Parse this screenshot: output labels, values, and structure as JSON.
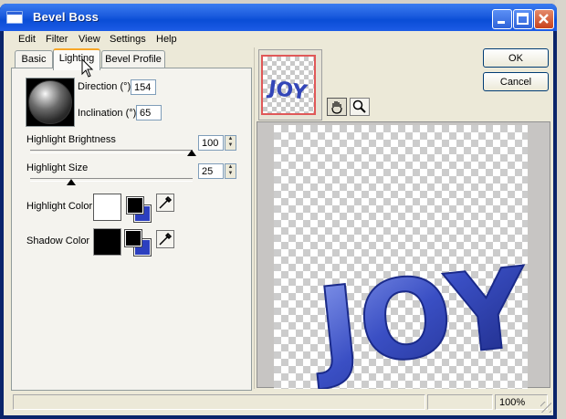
{
  "window": {
    "title": "Bevel Boss"
  },
  "menu": [
    "Edit",
    "Filter",
    "View",
    "Settings",
    "Help"
  ],
  "tabs": [
    {
      "label": "Basic",
      "active": false
    },
    {
      "label": "Lighting",
      "active": true
    },
    {
      "label": "Bevel Profile",
      "active": false
    }
  ],
  "lighting": {
    "direction_label": "Direction (°)",
    "direction_value": "154",
    "inclination_label": "Inclination (°)",
    "inclination_value": "65",
    "highlight_brightness_label": "Highlight Brightness",
    "highlight_brightness_value": "100",
    "highlight_size_label": "Highlight Size",
    "highlight_size_value": "25",
    "highlight_color_label": "Highlight Color",
    "shadow_color_label": "Shadow Color",
    "highlight_color": "#ffffff",
    "shadow_color": "#000000",
    "accent_color": "#2c3fbf"
  },
  "buttons": {
    "ok": "OK",
    "cancel": "Cancel"
  },
  "preview": {
    "text": "JOY",
    "text_color": "#3346b8"
  },
  "status": {
    "zoom": "100%"
  }
}
